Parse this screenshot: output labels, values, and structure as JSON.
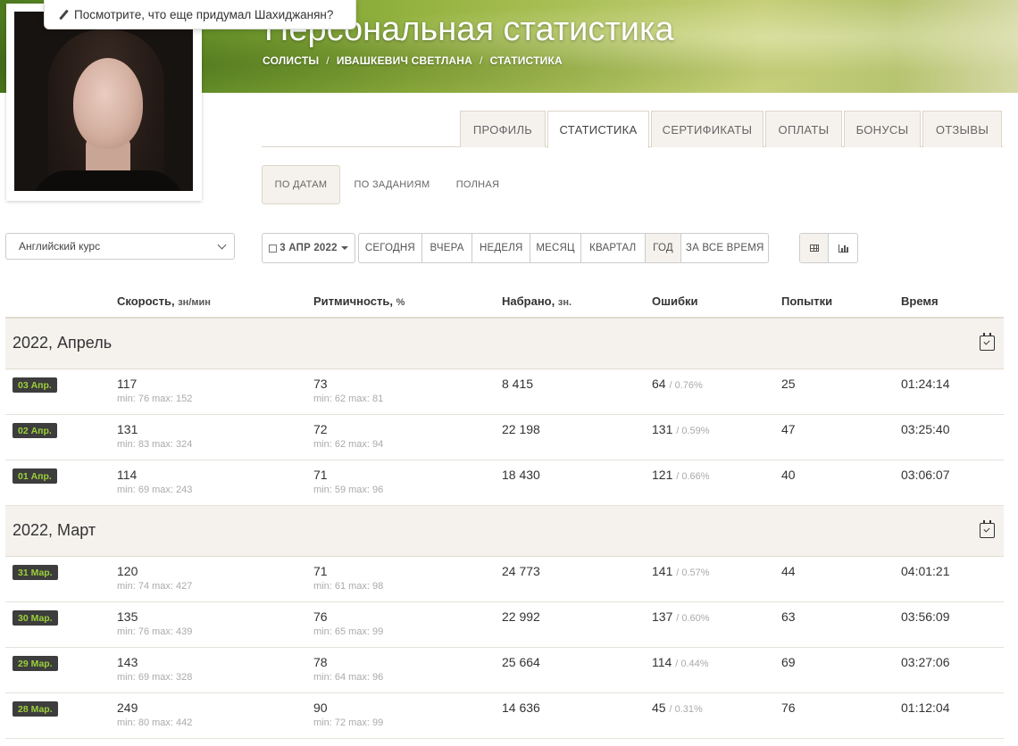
{
  "tooltip": {
    "text": "Посмотрите, что еще придумал Шахиджанян?"
  },
  "header": {
    "title": "Персональная статистика",
    "breadcrumb": [
      "СОЛИСТЫ",
      "ИВАШКЕВИЧ СВЕТЛАНА",
      "СТАТИСТИКА"
    ]
  },
  "tabs": [
    "ПРОФИЛЬ",
    "СТАТИСТИКА",
    "СЕРТИФИКАТЫ",
    "ОПЛАТЫ",
    "БОНУСЫ",
    "ОТЗЫВЫ"
  ],
  "active_tab": "СТАТИСТИКА",
  "subtabs": [
    "ПО ДАТАМ",
    "ПО ЗАДАНИЯМ",
    "ПОЛНАЯ"
  ],
  "active_subtab": "ПО ДАТАМ",
  "course_select": {
    "value": "Английский курс"
  },
  "date_button": "3 АПР 2022",
  "ranges": [
    "СЕГОДНЯ",
    "ВЧЕРА",
    "НЕДЕЛЯ",
    "МЕСЯЦ",
    "КВАРТАЛ",
    "ГОД",
    "ЗА ВСЕ ВРЕМЯ"
  ],
  "active_range": "ГОД",
  "columns": {
    "speed": "Скорость,",
    "speed_unit": "зн/мин",
    "rhythm": "Ритмичность,",
    "rhythm_unit": "%",
    "typed": "Набрано,",
    "typed_unit": "зн.",
    "errors": "Ошибки",
    "attempts": "Попытки",
    "time": "Время"
  },
  "groups": [
    {
      "month": "2022, Апрель",
      "rows": [
        {
          "date": "03 Апр.",
          "speed": "117",
          "speed_range": "min: 76 max: 152",
          "rhythm": "73",
          "rhythm_range": "min: 62 max: 81",
          "typed": "8 415",
          "errors": "64",
          "errors_pct": "/ 0.76%",
          "attempts": "25",
          "time": "01:24:14"
        },
        {
          "date": "02 Апр.",
          "speed": "131",
          "speed_range": "min: 83 max: 324",
          "rhythm": "72",
          "rhythm_range": "min: 62 max: 94",
          "typed": "22 198",
          "errors": "131",
          "errors_pct": "/ 0.59%",
          "attempts": "47",
          "time": "03:25:40"
        },
        {
          "date": "01 Апр.",
          "speed": "114",
          "speed_range": "min: 69 max: 243",
          "rhythm": "71",
          "rhythm_range": "min: 59 max: 96",
          "typed": "18 430",
          "errors": "121",
          "errors_pct": "/ 0.66%",
          "attempts": "40",
          "time": "03:06:07"
        }
      ]
    },
    {
      "month": "2022, Март",
      "rows": [
        {
          "date": "31 Мар.",
          "speed": "120",
          "speed_range": "min: 74 max: 427",
          "rhythm": "71",
          "rhythm_range": "min: 61 max: 98",
          "typed": "24 773",
          "errors": "141",
          "errors_pct": "/ 0.57%",
          "attempts": "44",
          "time": "04:01:21"
        },
        {
          "date": "30 Мар.",
          "speed": "135",
          "speed_range": "min: 76 max: 439",
          "rhythm": "76",
          "rhythm_range": "min: 65 max: 99",
          "typed": "22 992",
          "errors": "137",
          "errors_pct": "/ 0.60%",
          "attempts": "63",
          "time": "03:56:09"
        },
        {
          "date": "29 Мар.",
          "speed": "143",
          "speed_range": "min: 69 max: 328",
          "rhythm": "78",
          "rhythm_range": "min: 64 max: 96",
          "typed": "25 664",
          "errors": "114",
          "errors_pct": "/ 0.44%",
          "attempts": "69",
          "time": "03:27:06"
        },
        {
          "date": "28 Мар.",
          "speed": "249",
          "speed_range": "min: 80 max: 442",
          "rhythm": "90",
          "rhythm_range": "min: 72 max: 99",
          "typed": "14 636",
          "errors": "45",
          "errors_pct": "/ 0.31%",
          "attempts": "76",
          "time": "01:12:04"
        }
      ]
    }
  ],
  "colors": {
    "badge_bg": "#3d3d3d",
    "badge_text": "#9ccf3a",
    "accent_bg": "#f5f2ee"
  }
}
